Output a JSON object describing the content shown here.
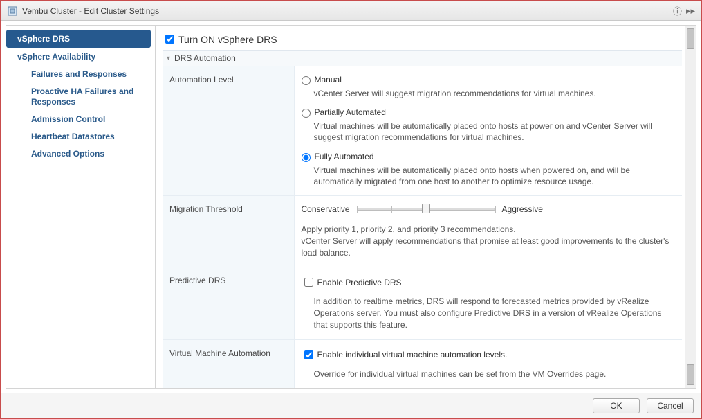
{
  "title": "Vembu Cluster - Edit Cluster Settings",
  "sidebar": {
    "items": [
      {
        "label": "vSphere DRS",
        "selected": true
      },
      {
        "label": "vSphere Availability",
        "selected": false
      }
    ],
    "subitems": [
      "Failures and Responses",
      "Proactive HA Failures and Responses",
      "Admission Control",
      "Heartbeat Datastores",
      "Advanced Options"
    ]
  },
  "drs": {
    "turn_on_label": "Turn ON vSphere DRS",
    "turn_on_checked": true,
    "section_header": "DRS Automation",
    "automation_level": {
      "label": "Automation Level",
      "selected": "fully",
      "options": {
        "manual": {
          "label": "Manual",
          "desc": "vCenter Server will suggest migration recommendations for virtual machines."
        },
        "partially": {
          "label": "Partially Automated",
          "desc": "Virtual machines will be automatically placed onto hosts at power on and vCenter Server will suggest migration recommendations for virtual machines."
        },
        "fully": {
          "label": "Fully Automated",
          "desc": "Virtual machines will be automatically placed onto hosts when powered on, and will be automatically migrated from one host to another to optimize resource usage."
        }
      }
    },
    "migration_threshold": {
      "label": "Migration Threshold",
      "left_label": "Conservative",
      "right_label": "Aggressive",
      "value_percent": 50,
      "desc": "Apply priority 1, priority 2, and priority 3 recommendations.\nvCenter Server will apply recommendations that promise at least good improvements to the cluster's load balance."
    },
    "predictive": {
      "label": "Predictive DRS",
      "checkbox_label": "Enable Predictive DRS",
      "checked": false,
      "desc": "In addition to realtime metrics, DRS will respond to forecasted metrics provided by vRealize Operations server. You must also configure Predictive DRS in a version of vRealize Operations that supports this feature."
    },
    "vm_automation": {
      "label": "Virtual Machine Automation",
      "checkbox_label": "Enable individual virtual machine automation levels.",
      "checked": true,
      "desc": "Override for individual virtual machines can be set from the VM Overrides page."
    }
  },
  "buttons": {
    "ok": "OK",
    "cancel": "Cancel"
  }
}
